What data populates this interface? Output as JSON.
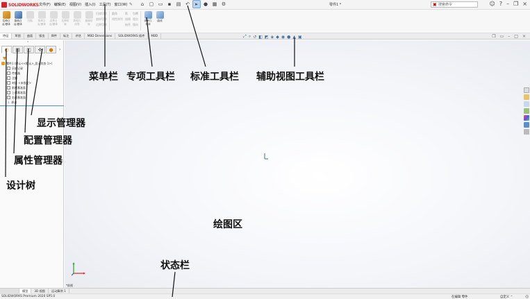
{
  "app": {
    "logo_text": "SOLIDWORKS",
    "menu": [
      "文件(F)",
      "编辑(E)",
      "视图(V)",
      "插入(I)",
      "工具(T)",
      "窗口(W)"
    ],
    "document_title": "零件1 *",
    "search_placeholder": "搜索命令",
    "brand_color": "#d8232a"
  },
  "ribbon": {
    "big_buttons": [
      {
        "label": "拉伸凸台/基体",
        "icon": "extrude-boss-icon"
      },
      {
        "label": "旋转凸台/基体",
        "icon": "revolve-boss-icon"
      },
      {
        "label": "扫描",
        "icon": "sweep-icon"
      },
      {
        "label": "放样凸台/基体",
        "icon": "loft-icon"
      },
      {
        "label": "边界凸台/基体",
        "icon": "boundary-boss-icon"
      },
      {
        "label": "拉伸切除",
        "icon": "extrude-cut-icon"
      },
      {
        "label": "异型孔向导",
        "icon": "hole-wizard-icon"
      },
      {
        "label": "旋转切除",
        "icon": "revolve-cut-icon"
      }
    ],
    "small_col1": [
      "扫描切除",
      "放样切割",
      "边界切除"
    ],
    "small_col2": [
      "圆角",
      "线性阵列"
    ],
    "small_col3": [
      "筋",
      "拔模",
      "抽壳"
    ],
    "small_col4": [
      "包覆",
      "相交",
      "镜向"
    ],
    "right_buttons": [
      {
        "label": "参考几何体",
        "icon": "ref-geometry-icon"
      },
      {
        "label": "曲线",
        "icon": "curves-icon"
      }
    ]
  },
  "cm_tabs": [
    "特征",
    "草图",
    "曲面",
    "钣金",
    "焊件",
    "标注",
    "评估",
    "MBD Dimensions",
    "SOLIDWORKS 插件",
    "MBD"
  ],
  "cm_active": "特征",
  "feature_tree": {
    "root": "零件1 (默认<<默认>_显示状态 1>)",
    "items": [
      "历史记录",
      "传感器",
      "注解",
      "材质 <未指定>",
      "前视基准面",
      "上视基准面",
      "右视基准面",
      "原点"
    ]
  },
  "model_tabs": [
    "模型",
    "3D 视图",
    "运动算例 1"
  ],
  "model_active": "模型",
  "status": {
    "product": "SOLIDWORKS Premium 2020 SP5.0",
    "editing": "在编辑 零件",
    "units": "自定义"
  },
  "triad_label": "*前视",
  "annotations": {
    "menu_bar": "菜单栏",
    "special_toolbar": "专项工具栏",
    "standard_toolbar": "标准工具栏",
    "heads_up_toolbar": "辅助视图工具栏",
    "display_manager": "显示管理器",
    "config_manager": "配置管理器",
    "property_manager": "属性管理器",
    "design_tree": "设计树",
    "graphics_area": "绘图区",
    "status_bar": "状态栏"
  }
}
